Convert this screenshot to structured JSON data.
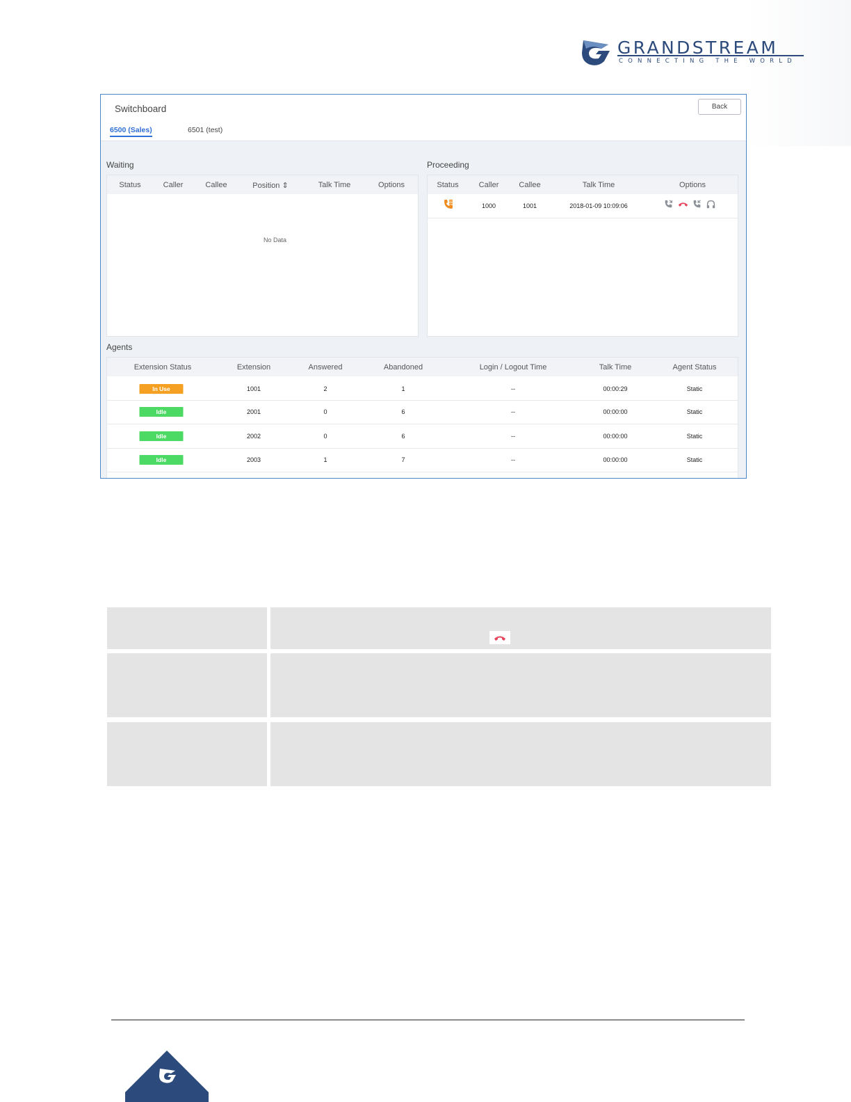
{
  "brand": {
    "name": "GRANDSTREAM",
    "tagline": "CONNECTING THE WORLD",
    "color": "#2c4a7c"
  },
  "switchboard": {
    "title": "Switchboard",
    "back_label": "Back",
    "tabs": [
      {
        "label": "6500 (Sales)",
        "active": true
      },
      {
        "label": "6501 (test)",
        "active": false
      }
    ],
    "waiting": {
      "label": "Waiting",
      "columns": [
        "Status",
        "Caller",
        "Callee",
        "Position ⇕",
        "Talk Time",
        "Options"
      ],
      "empty_text": "No Data"
    },
    "proceeding": {
      "label": "Proceeding",
      "columns": [
        "Status",
        "Caller",
        "Callee",
        "Talk Time",
        "Options"
      ],
      "rows": [
        {
          "status_icon": "incoming-call-icon",
          "caller": "1000",
          "callee": "1001",
          "talk_time": "2018-01-09 10:09:06",
          "options": [
            "barge-in-icon",
            "hangup-icon",
            "transfer-icon",
            "listen-icon"
          ]
        }
      ]
    },
    "agents": {
      "label": "Agents",
      "columns": [
        "Extension Status",
        "Extension",
        "Answered",
        "Abandoned",
        "Login / Logout Time",
        "Talk Time",
        "Agent Status"
      ],
      "rows": [
        {
          "status": "In Use",
          "status_color": "#f5a023",
          "extension": "1001",
          "answered": "2",
          "abandoned": "1",
          "login": "--",
          "talk_time": "00:00:29",
          "agent_status": "Static"
        },
        {
          "status": "Idle",
          "status_color": "#4cd964",
          "extension": "2001",
          "answered": "0",
          "abandoned": "6",
          "login": "--",
          "talk_time": "00:00:00",
          "agent_status": "Static"
        },
        {
          "status": "Idle",
          "status_color": "#4cd964",
          "extension": "2002",
          "answered": "0",
          "abandoned": "6",
          "login": "--",
          "talk_time": "00:00:00",
          "agent_status": "Static"
        },
        {
          "status": "Idle",
          "status_color": "#4cd964",
          "extension": "2003",
          "answered": "1",
          "abandoned": "7",
          "login": "--",
          "talk_time": "00:00:00",
          "agent_status": "Static"
        }
      ]
    }
  },
  "options_table": {
    "hangup_icon": "hangup-icon",
    "hangup_color": "#e8455c"
  }
}
